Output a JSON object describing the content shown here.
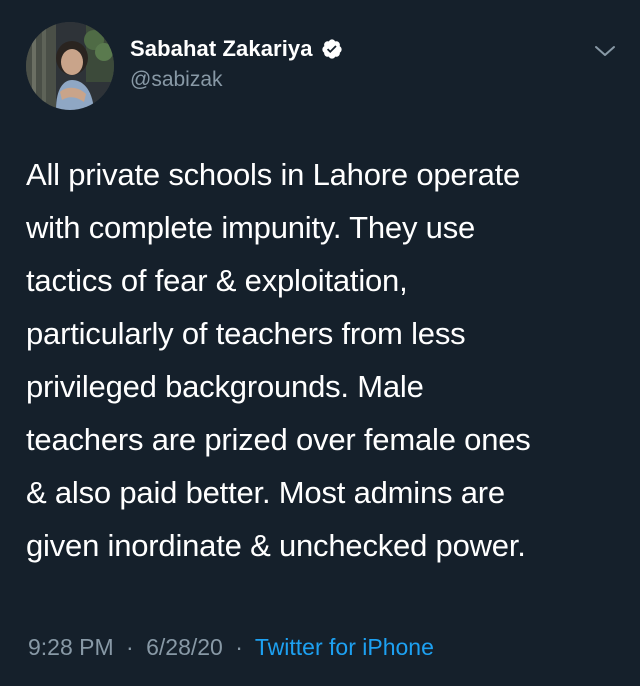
{
  "colors": {
    "background": "#15202b",
    "primary_text": "#ffffff",
    "secondary_text": "#8899a6",
    "link": "#1da1f2",
    "verified_badge": "#ffffff"
  },
  "author": {
    "display_name": "Sabahat Zakariya",
    "handle": "@sabizak",
    "verified": true,
    "avatar_icon": "profile-photo"
  },
  "menu_icon": "chevron-down-icon",
  "tweet": {
    "lines": [
      "All private schools in Lahore operate",
      "with complete impunity. They use",
      "tactics of fear & exploitation,",
      "particularly of teachers from less",
      "privileged backgrounds. Male",
      "teachers are prized over female ones",
      "& also paid better. Most admins are",
      "given inordinate & unchecked power."
    ]
  },
  "meta": {
    "time": "9:28 PM",
    "separator": "·",
    "date": "6/28/20",
    "source": "Twitter for iPhone"
  }
}
